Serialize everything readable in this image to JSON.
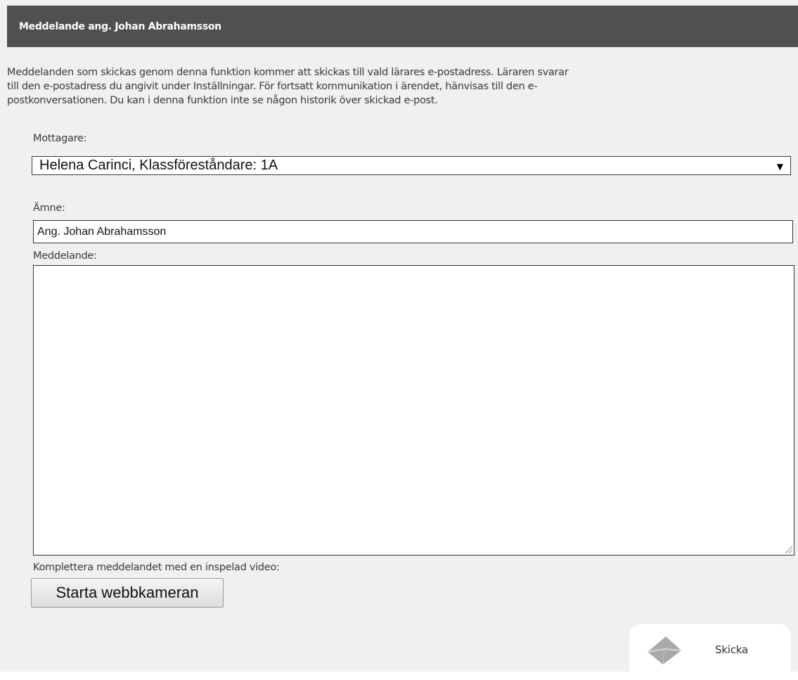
{
  "dialog": {
    "title": "Meddelande ang. Johan Abrahamsson",
    "intro_lines": [
      "Meddelanden som skickas genom denna funktion kommer att skickas till vald lärares e-postadress. Läraren svarar",
      "till den e-postadress du angivit under Inställningar. För fortsatt kommunikation i ärendet, hänvisas till den e-",
      "postkonversationen. Du kan i denna funktion inte se någon historik över skickad e-post."
    ]
  },
  "form": {
    "recipient": {
      "label": "Mottagare:",
      "selected": "Helena Carinci, Klassföreståndare: 1A"
    },
    "subject": {
      "label": "Ämne:",
      "value": "Ang. Johan Abrahamsson"
    },
    "message": {
      "label": "Meddelande:",
      "value": ""
    },
    "video": {
      "label": "Komplettera meddelandet med en inspelad video:",
      "button_label": "Starta webbkameran"
    }
  },
  "actions": {
    "send_label": "Skicka",
    "send_icon": "envelope-icon"
  },
  "colors": {
    "titlebar": "#505050",
    "background": "#f0f0f0",
    "text": "#3a3a3a"
  }
}
